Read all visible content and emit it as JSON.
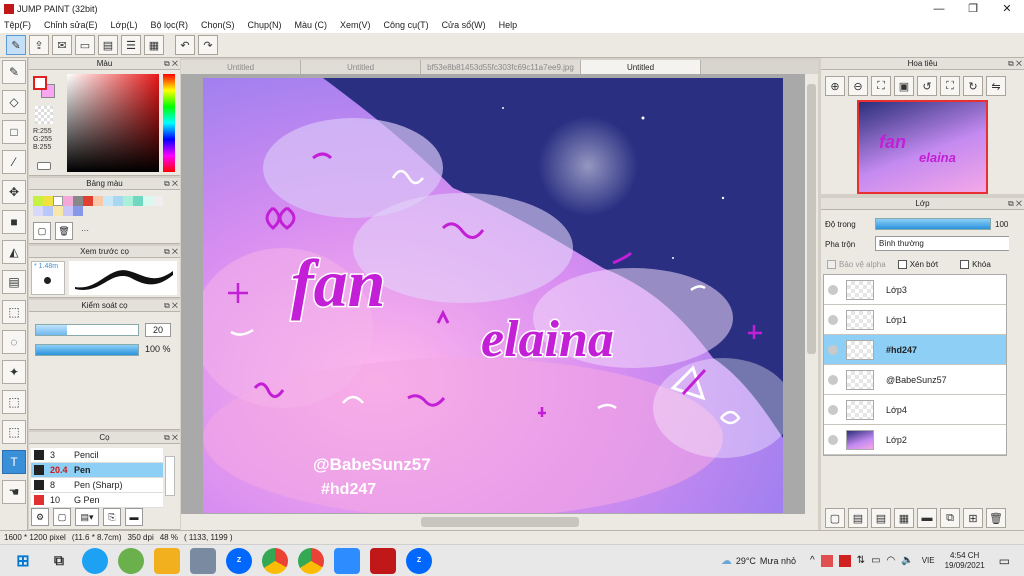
{
  "window": {
    "title": "JUMP PAINT (32bit)",
    "minimize": "—",
    "restore": "❐",
    "close": "✕"
  },
  "menu": [
    "Tệp(F)",
    "Chỉnh sửa(E)",
    "Lớp(L)",
    "Bộ lọc(R)",
    "Chọn(S)",
    "Chụp(N)",
    "Màu (C)",
    "Xem(V)",
    "Công cụ(T)",
    "Cửa sổ(W)",
    "Help"
  ],
  "tabs": [
    {
      "label": "Untitled",
      "active": false
    },
    {
      "label": "Untitled",
      "active": false
    },
    {
      "label": "bf53e8b81453d55fc303fc69c11a7ee9.jpg",
      "active": false
    },
    {
      "label": "Untitled",
      "active": true
    }
  ],
  "color_panel": {
    "title": "Màu",
    "r": "R:255",
    "g": "G:255",
    "b": "B:255"
  },
  "swatch_panel": {
    "title": "Bảng màu",
    "more": "···"
  },
  "brush_preview": {
    "title": "Xem trước cọ",
    "size": "* 1.48m"
  },
  "brush_control": {
    "title": "Kiểm soát cọ",
    "size_value": "20",
    "opacity_value": "100 %",
    "opacity_fraction": 1.0,
    "size_fraction": 0.3
  },
  "brushes": {
    "title": "Cọ",
    "items": [
      {
        "size": "3",
        "name": "Pencil",
        "color": "#222222",
        "selected": false
      },
      {
        "size": "20.4",
        "name": "Pen",
        "color": "#222222",
        "selected": true
      },
      {
        "size": "8",
        "name": "Pen (Sharp)",
        "color": "#222222",
        "selected": false
      },
      {
        "size": "10",
        "name": "G Pen",
        "color": "#e03030",
        "selected": false
      }
    ]
  },
  "canvas_art": {
    "title_line1": "fan",
    "title_line2": "elaina",
    "handle": "@BabeSunz57",
    "tag": "#hd247"
  },
  "navigator": {
    "title": "Hoa tiêu"
  },
  "layers": {
    "title": "Lớp",
    "opacity_label": "Độ trong",
    "opacity_value": "100 %",
    "opacity_fraction": 1.0,
    "blend_label": "Pha trộn",
    "blend_value": "Bình thường",
    "alpha_label": "Bảo vệ alpha",
    "clip_label": "Xén bớt",
    "lock_label": "Khóa",
    "items": [
      {
        "name": "Lớp3",
        "selected": false
      },
      {
        "name": "Lớp1",
        "selected": false
      },
      {
        "name": "#hd247",
        "selected": true
      },
      {
        "name": "@BabeSunz57",
        "selected": false
      },
      {
        "name": "Lớp4",
        "selected": false
      },
      {
        "name": "Lớp2",
        "selected": false
      }
    ]
  },
  "status": {
    "size": "1600 * 1200 pixel",
    "physical": "(11.6 * 8.7cm)",
    "dpi": "350 dpi",
    "zoom": "48 %",
    "coords": "( 1133, 1199 )"
  },
  "taskbar": {
    "temp": "29°C",
    "weather": "Mưa nhỏ",
    "lang": "VIE",
    "time": "4:54 CH",
    "date": "19/09/2021"
  },
  "colors": {
    "accent": "#3a8fd9",
    "selected_row": "#8ecff6",
    "title_pink": "#c21fd6"
  }
}
